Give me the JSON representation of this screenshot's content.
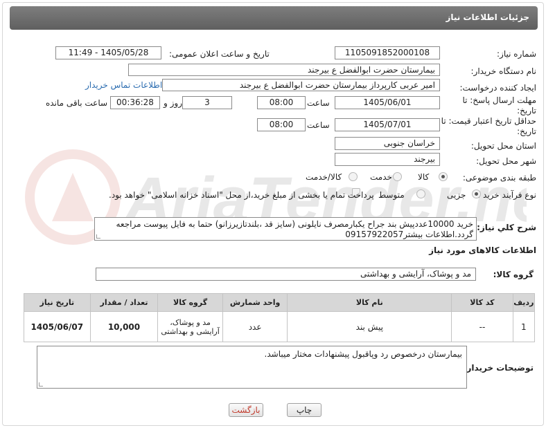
{
  "header": {
    "title": "جزئیات اطلاعات نیاز"
  },
  "need_number": {
    "label": "شماره نیاز:",
    "value": "1105091852000108"
  },
  "announce": {
    "label": "تاریخ و ساعت اعلان عمومی:",
    "value": "1405/05/28 - 11:49"
  },
  "buyer_org": {
    "label": "نام دستگاه خریدار:",
    "value": "بیمارستان حضرت ابوالفضل  ع  بیرجند"
  },
  "requester": {
    "label": "ایجاد کننده درخواست:",
    "value": "امیر عربی کارپرداز بیمارستان حضرت ابوالفضل  ع  بیرجند",
    "contact_link": "اطلاعات تماس خریدار"
  },
  "deadline": {
    "label": "مهلت ارسال پاسخ: تا تاریخ:",
    "date": "1405/06/01",
    "time_label": "ساعت",
    "time": "08:00",
    "days": "3",
    "days_label": "روز و",
    "remaining": "00:36:28",
    "remaining_label": "ساعت باقی مانده"
  },
  "price_validity": {
    "label": "حداقل تاریخ اعتبار قیمت: تا تاریخ:",
    "date": "1405/07/01",
    "time_label": "ساعت",
    "time": "08:00"
  },
  "province": {
    "label": "استان محل تحویل:",
    "value": "خراسان جنوبی"
  },
  "city": {
    "label": "شهر محل تحویل:",
    "value": "بیرجند"
  },
  "category": {
    "label": "طبقه بندی موضوعی:",
    "options": [
      "کالا",
      "خدمت",
      "کالا/خدمت"
    ],
    "selected": "کالا"
  },
  "process": {
    "label": "نوع فرآیند خرید :",
    "options": [
      "جزیی",
      "متوسط"
    ],
    "selected": "جزیی",
    "payment_note": "پرداخت تمام یا بخشی از مبلغ خرید،از محل \"اسناد خزانه اسلامی\" خواهد بود."
  },
  "description": {
    "label": "شرح کلي نياز:",
    "text_prefix": "خرید ",
    "text_number": "10000",
    "text_middle": "عددپیش بند جراح یکبارمصرف نایلونی (سایز قد ،بلندتازیرزانو) حتما به فایل پیوست مراجعه گردد.اطلاعات بیشتر",
    "text_phone": "09157922057"
  },
  "goods_info": {
    "title": "اطلاعات کالاهای مورد نیاز"
  },
  "goods_group": {
    "label": "گروه کالا:",
    "value": "مد و پوشاک، آرایشی و بهداشتی"
  },
  "table": {
    "headers": [
      "ردیف",
      "کد کالا",
      "نام کالا",
      "واحد شمارش",
      "گروه کالا",
      "تعداد / مقدار",
      "تاریخ نیاز"
    ],
    "rows": [
      [
        "1",
        "--",
        "پیش بند",
        "عدد",
        "مد و پوشاک، آرایشی و بهداشتی",
        "10,000",
        "1405/06/07"
      ]
    ]
  },
  "buyer_notes": {
    "label": "توضیحات خریدار:",
    "text": "بیمارستان درخصوص رد وپاقبول پیشنهادات مختار میباشد."
  },
  "buttons": {
    "print": "چاپ",
    "back": "بازگشت"
  }
}
